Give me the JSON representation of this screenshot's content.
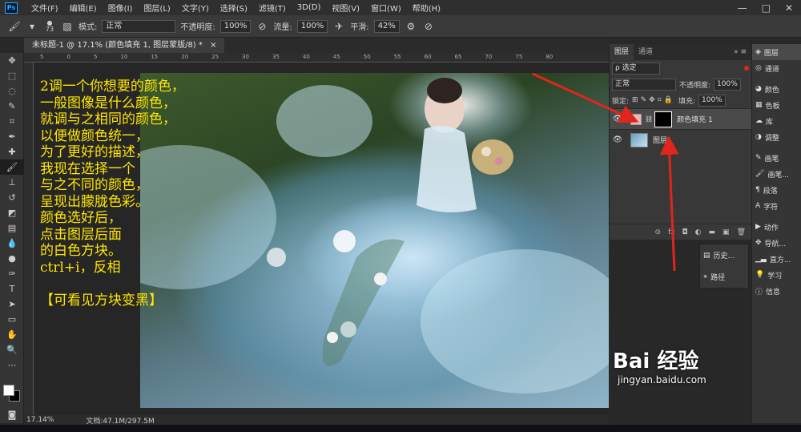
{
  "app": {
    "logo": "Ps"
  },
  "menu": [
    "文件(F)",
    "编辑(E)",
    "图像(I)",
    "图层(L)",
    "文字(Y)",
    "选择(S)",
    "滤镜(T)",
    "3D(D)",
    "视图(V)",
    "窗口(W)",
    "帮助(H)"
  ],
  "window_controls": {
    "minimize": "—",
    "maximize": "□",
    "close": "✕"
  },
  "options": {
    "brush_size": "73",
    "mode_label": "模式:",
    "mode_value": "正常",
    "opacity_label": "不透明度:",
    "opacity_value": "100%",
    "flow_label": "流量:",
    "flow_value": "100%",
    "smoothing_label": "平滑:",
    "smoothing_value": "42%"
  },
  "document_tab": {
    "title": "未标题-1 @ 17.1% (颜色填充 1, 图层蒙版/8) *",
    "close": "×"
  },
  "ruler_ticks": [
    "5",
    "0",
    "5",
    "10",
    "15",
    "20",
    "25",
    "30",
    "35",
    "40",
    "45",
    "50",
    "55",
    "60",
    "65",
    "70",
    "75",
    "80"
  ],
  "annotation_lines": [
    "2调一个你想要的颜色，",
    "一般图像是什么颜色，",
    "就调与之相同的颜色，",
    "以便做颜色统一，",
    "为了更好的描述，",
    "我现在选择一个",
    "与之不同的颜色，",
    "呈现出朦胧色彩。",
    "颜色选好后，",
    "点击图层后面",
    "的白色方块。",
    "ctrl+i，反相",
    "",
    "【可看见方块变黑】"
  ],
  "layers_panel": {
    "tabs": [
      "图层",
      "通道"
    ],
    "filter_label": "ρ 选定",
    "blend_mode": "正常",
    "opacity_label": "不透明度:",
    "opacity_value": "100%",
    "lock_label": "锁定:",
    "fill_label": "填充:",
    "fill_value": "100%",
    "layers": [
      {
        "name": "颜色填充 1",
        "selected": true
      },
      {
        "name": "图层",
        "selected": false
      }
    ],
    "footer_icons": [
      "⊝",
      "fx",
      "◘",
      "◐",
      "▬",
      "▣",
      "🗑"
    ]
  },
  "mini_panel": [
    {
      "icon": "history-icon",
      "label": "历史..."
    },
    {
      "icon": "paths-icon",
      "label": "路径"
    }
  ],
  "dock": [
    {
      "icon": "layers-icon",
      "label": "图层"
    },
    {
      "icon": "channels-icon",
      "label": "通道"
    },
    {
      "icon": "color-icon",
      "label": "颜色"
    },
    {
      "icon": "swatches-icon",
      "label": "色板"
    },
    {
      "icon": "libraries-icon",
      "label": "库"
    },
    {
      "icon": "adjustments-icon",
      "label": "调整"
    },
    {
      "icon": "brush-icon",
      "label": "画笔"
    },
    {
      "icon": "brush-presets-icon",
      "label": "画笔..."
    },
    {
      "icon": "paragraph-icon",
      "label": "段落"
    },
    {
      "icon": "character-icon",
      "label": "字符"
    },
    {
      "icon": "actions-icon",
      "label": "动作"
    },
    {
      "icon": "navigator-icon",
      "label": "导航..."
    },
    {
      "icon": "histogram-icon",
      "label": "直方..."
    },
    {
      "icon": "learn-icon",
      "label": "学习"
    },
    {
      "icon": "info-icon",
      "label": "信息"
    }
  ],
  "status": {
    "zoom": "17.14%",
    "doc_info": "文档:47.1M/297.5M"
  },
  "watermark": {
    "logo": "Bai 经验",
    "url": "jingyan.baidu.com"
  },
  "colors": {
    "annotation": "#ffe600",
    "arrow": "#e0261b",
    "fill_swatch": "#f0b8b4"
  }
}
